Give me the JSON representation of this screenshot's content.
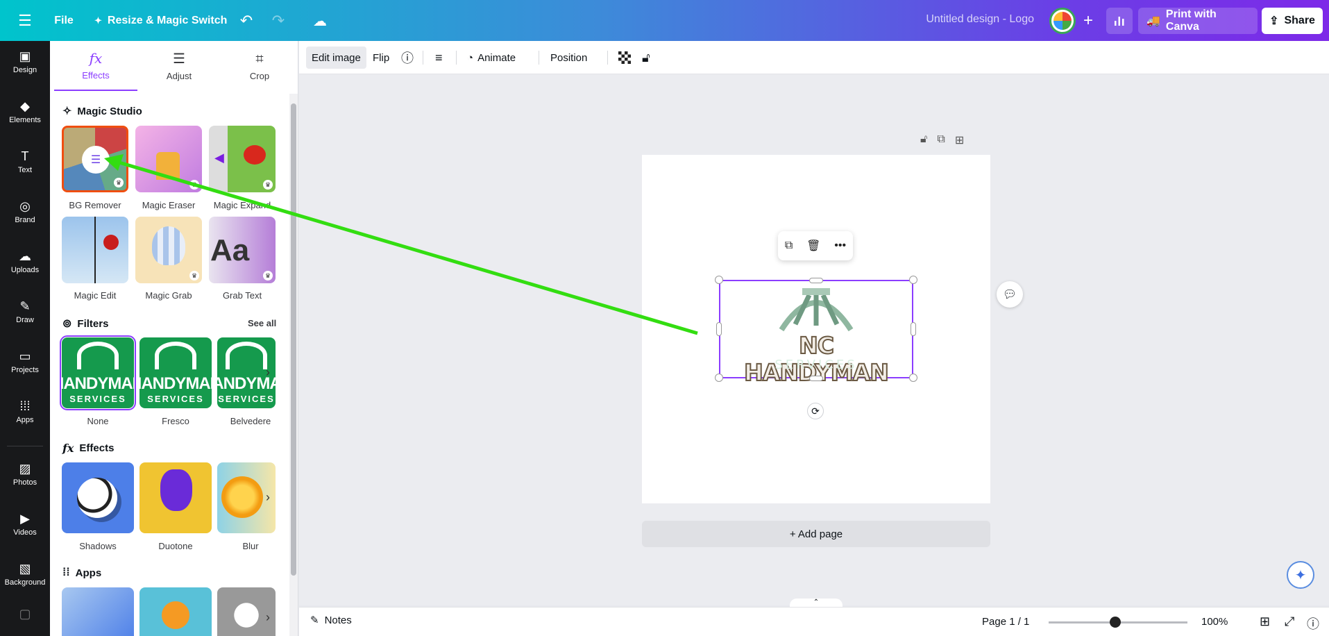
{
  "topbar": {
    "file_label": "File",
    "resize_label": "Resize & Magic Switch",
    "design_title": "Untitled design - Logo",
    "print_label": "Print with Canva",
    "share_label": "Share",
    "gradient": [
      "#00c4cc",
      "#7d2ae8"
    ]
  },
  "rail": {
    "items": [
      {
        "label": "Design",
        "icon": "layout-icon"
      },
      {
        "label": "Elements",
        "icon": "shapes-icon"
      },
      {
        "label": "Text",
        "icon": "text-icon"
      },
      {
        "label": "Brand",
        "icon": "brand-icon"
      },
      {
        "label": "Uploads",
        "icon": "cloud-upload-icon"
      },
      {
        "label": "Draw",
        "icon": "pen-icon"
      },
      {
        "label": "Projects",
        "icon": "folder-icon"
      },
      {
        "label": "Apps",
        "icon": "apps-grid-icon"
      },
      {
        "label": "Photos",
        "icon": "photo-icon"
      },
      {
        "label": "Videos",
        "icon": "video-icon"
      },
      {
        "label": "Background",
        "icon": "background-icon"
      }
    ]
  },
  "panel": {
    "tabs": [
      {
        "label": "Effects",
        "icon": "fx"
      },
      {
        "label": "Adjust",
        "icon": "sliders-icon"
      },
      {
        "label": "Crop",
        "icon": "crop-icon"
      }
    ],
    "magic_studio": {
      "title": "Magic Studio",
      "tools": [
        "BG Remover",
        "Magic Eraser",
        "Magic Expand",
        "Magic Edit",
        "Magic Grab",
        "Grab Text"
      ]
    },
    "filters": {
      "title": "Filters",
      "see_all": "See all",
      "items": [
        "None",
        "Fresco",
        "Belvedere"
      ],
      "tile_text": "HANDYMAN",
      "tile_sub": "SERVICES"
    },
    "effects": {
      "title": "Effects",
      "items": [
        "Shadows",
        "Duotone",
        "Blur"
      ]
    },
    "apps": {
      "title": "Apps"
    }
  },
  "context_toolbar": {
    "edit_image": "Edit image",
    "flip": "Flip",
    "animate": "Animate",
    "position": "Position"
  },
  "canvas": {
    "logo_main": "NC HANDYMAN",
    "logo_sub": "SERVICES",
    "add_page": "+ Add page",
    "selection_color": "#8b3dff"
  },
  "bottombar": {
    "notes": "Notes",
    "page_count": "Page 1 / 1",
    "zoom": "100%",
    "zoom_fraction": 0.48
  },
  "annotation": {
    "arrow_color": "#33dd11"
  }
}
